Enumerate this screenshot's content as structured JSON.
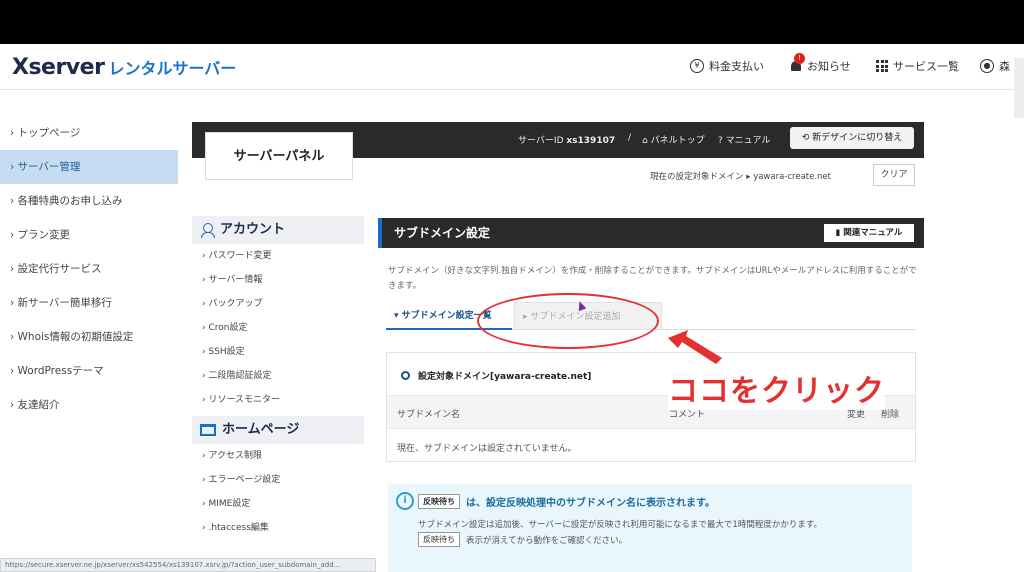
{
  "header": {
    "logo_main": "Xserver",
    "logo_sub": "レンタルサーバー",
    "payment": "料金支払い",
    "notice": "お知らせ",
    "services": "サービス一覧",
    "user": "森"
  },
  "left_nav": [
    {
      "label": "トップページ",
      "active": false
    },
    {
      "label": "サーバー管理",
      "active": true
    },
    {
      "label": "各種特典のお申し込み",
      "active": false
    },
    {
      "label": "プラン変更",
      "active": false
    },
    {
      "label": "設定代行サービス",
      "active": false
    },
    {
      "label": "新サーバー簡単移行",
      "active": false
    },
    {
      "label": "Whois情報の初期値設定",
      "active": false
    },
    {
      "label": "WordPressテーマ",
      "active": false
    },
    {
      "label": "友達紹介",
      "active": false
    }
  ],
  "panel": {
    "title": "サーバーパネル",
    "server_id_label": "サーバーID",
    "server_id": "xs139107",
    "panel_top": "パネルトップ",
    "manual": "マニュアル",
    "new_design": "新デザインに切り替え",
    "current_domain_label": "現在の設定対象ドメイン",
    "current_domain": "yawara-create.net",
    "clear": "クリア"
  },
  "menu": {
    "account_head": "アカウント",
    "account_items": [
      "パスワード変更",
      "サーバー情報",
      "バックアップ",
      "Cron設定",
      "SSH設定",
      "二段階認証設定",
      "リソースモニター"
    ],
    "homepage_head": "ホームページ",
    "homepage_items": [
      "アクセス制限",
      "エラーページ設定",
      "MIME設定",
      ".htaccess編集"
    ]
  },
  "content": {
    "title": "サブドメイン設定",
    "manual_btn": "関連マニュアル",
    "description": "サブドメイン（好きな文字列.独自ドメイン）を作成・削除することができます。サブドメインはURLやメールアドレスに利用することができます。",
    "tab_list": "サブドメイン設定一覧",
    "tab_add": "サブドメイン設定追加",
    "target_domain": "設定対象ドメイン[yawara-create.net]",
    "col_subdomain": "サブドメイン名",
    "col_comment": "コメント",
    "col_change": "変更",
    "col_delete": "削除",
    "empty_message": "現在、サブドメインは設定されていません。"
  },
  "annotation": {
    "text": "ココをクリック",
    "color": "#e53030"
  },
  "note": {
    "tag": "反映待ち",
    "line1": "は、設定反映処理中のサブドメイン名に表示されます。",
    "line2": "サブドメイン設定は追加後、サーバーに設定が反映され利用可能になるまで最大で1時間程度かかります。",
    "line3": "表示が消えてから動作をご確認ください。"
  },
  "statusbar": {
    "url": "https://secure.xserver.ne.jp/xserver/xs542554/xs139107.xsrv.jp/?action_user_subdomain_add..."
  }
}
